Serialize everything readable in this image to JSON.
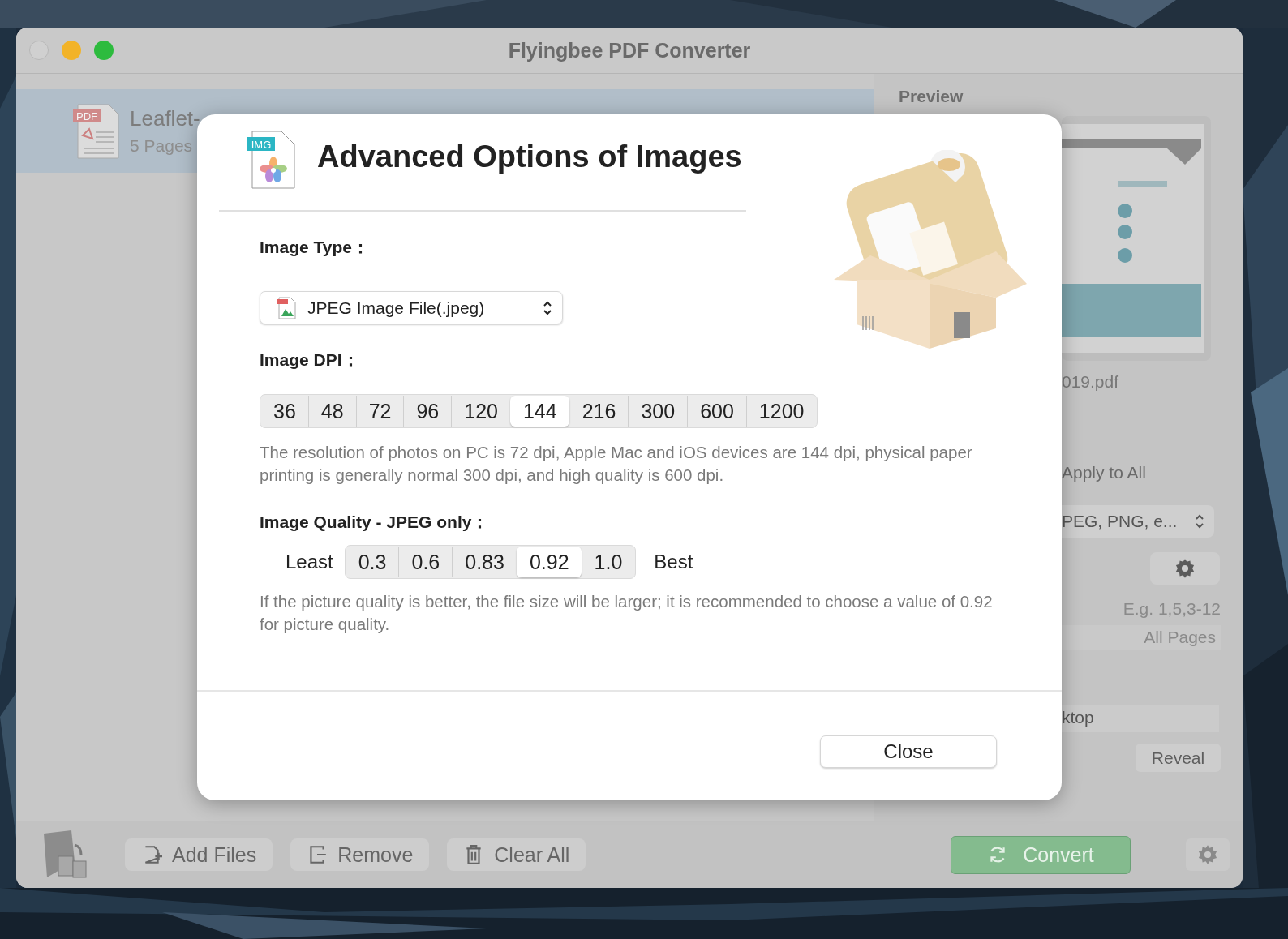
{
  "window": {
    "title": "Flyingbee PDF Converter"
  },
  "file_list": [
    {
      "tag": "PDF",
      "name": "Leaflet-",
      "pages": "5 Pages",
      "selected": true
    }
  ],
  "preview": {
    "heading": "Preview",
    "file_name": "019.pdf"
  },
  "options": {
    "apply_to_all": "Apply to All",
    "format": "PEG, PNG, e...",
    "page_hint": "E.g. 1,5,3-12",
    "pages_placeholder": "All Pages",
    "output_folder": "ktop",
    "reveal": "Reveal"
  },
  "toolbar": {
    "buttons": [
      {
        "label": "Add Files",
        "kind": "add"
      },
      {
        "label": "Remove",
        "kind": "remove"
      },
      {
        "label": "Clear All",
        "kind": "clear"
      }
    ],
    "convert": "Convert"
  },
  "dialog": {
    "icon_tag": "IMG",
    "title": "Advanced Options of Images",
    "image_type_label": "Image Type：",
    "image_type": "JPEG Image File(.jpeg)",
    "dpi_label": "Image DPI：",
    "dpi_options": [
      {
        "label": "36",
        "selected": false
      },
      {
        "label": "48",
        "selected": false
      },
      {
        "label": "72",
        "selected": false
      },
      {
        "label": "96",
        "selected": false
      },
      {
        "label": "120",
        "selected": false
      },
      {
        "label": "144",
        "selected": true
      },
      {
        "label": "216",
        "selected": false
      },
      {
        "label": "300",
        "selected": false
      },
      {
        "label": "600",
        "selected": false
      },
      {
        "label": "1200",
        "selected": false
      }
    ],
    "dpi_note": "The resolution of photos on PC is 72 dpi, Apple Mac and iOS devices are 144 dpi, physical paper printing is generally normal 300 dpi, and high quality is 600 dpi.",
    "quality_label": "Image Quality - JPEG only：",
    "quality_min": "Least",
    "quality_max": "Best",
    "quality_options": [
      {
        "label": "0.3",
        "selected": false
      },
      {
        "label": "0.6",
        "selected": false
      },
      {
        "label": "0.83",
        "selected": false
      },
      {
        "label": "0.92",
        "selected": true
      },
      {
        "label": "1.0",
        "selected": false
      }
    ],
    "quality_note": "If the picture quality is better, the file size will be larger; it is recommended to choose a value of 0.92 for picture quality.",
    "close": "Close"
  }
}
